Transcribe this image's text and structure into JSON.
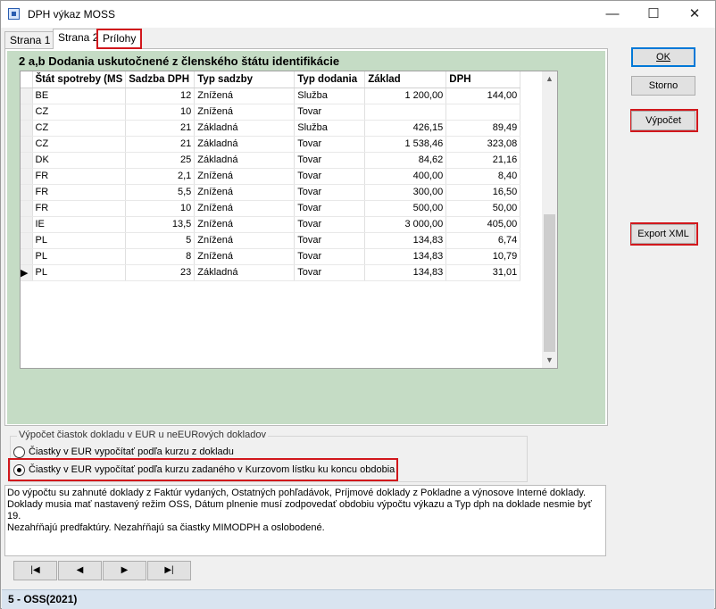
{
  "window": {
    "title": "DPH výkaz MOSS",
    "minimize": "—",
    "maximize": "☐",
    "close": "✕"
  },
  "tabs": [
    "Strana 1",
    "Strana 2",
    "Prílohy"
  ],
  "section_title": "2 a,b Dodania uskutočnené z členského štátu identifikácie",
  "table": {
    "columns": [
      "Štát spotreby (MS",
      "Sadzba DPH",
      "Typ sadzby",
      "Typ dodania",
      "Základ",
      "DPH"
    ],
    "rows": [
      [
        "BE",
        "12",
        "Znížená",
        "Služba",
        "1 200,00",
        "144,00"
      ],
      [
        "CZ",
        "10",
        "Znížená",
        "Tovar",
        "",
        ""
      ],
      [
        "CZ",
        "21",
        "Základná",
        "Služba",
        "426,15",
        "89,49"
      ],
      [
        "CZ",
        "21",
        "Základná",
        "Tovar",
        "1 538,46",
        "323,08"
      ],
      [
        "DK",
        "25",
        "Základná",
        "Tovar",
        "84,62",
        "21,16"
      ],
      [
        "FR",
        "2,1",
        "Znížená",
        "Tovar",
        "400,00",
        "8,40"
      ],
      [
        "FR",
        "5,5",
        "Znížená",
        "Tovar",
        "300,00",
        "16,50"
      ],
      [
        "FR",
        "10",
        "Znížená",
        "Tovar",
        "500,00",
        "50,00"
      ],
      [
        "IE",
        "13,5",
        "Znížená",
        "Tovar",
        "3 000,00",
        "405,00"
      ],
      [
        "PL",
        "5",
        "Znížená",
        "Tovar",
        "134,83",
        "6,74"
      ],
      [
        "PL",
        "8",
        "Znížená",
        "Tovar",
        "134,83",
        "10,79"
      ],
      [
        "PL",
        "23",
        "Základná",
        "Tovar",
        "134,83",
        "31,01"
      ]
    ],
    "current_row_marker": "▶"
  },
  "calc": {
    "legend": "Výpočet čiastok dokladu v EUR u neEURových dokladov",
    "option1": "Čiastky v EUR vypočítať podľa kurzu z dokladu",
    "option2": "Čiastky v EUR vypočítať podľa kurzu zadaného v Kurzovom lístku ku koncu obdobia"
  },
  "info_lines": [
    "Do výpočtu su zahnuté doklady z Faktúr vydaných, Ostatných pohľadávok, Príjmové doklady z Pokladne a výnosove Interné doklady.",
    "Doklady musia mať nastavený režim OSS, Dátum plnenie musí zodpovedať obdobiu výpočtu výkazu a Typ dph na doklade nesmie byť 19.",
    "Nezahŕňajú predfaktúry. Nezahŕňajú sa čiastky MIMODPH a oslobodené."
  ],
  "nav": {
    "first": "|◀",
    "prev": "◀",
    "next": "▶",
    "last": "▶|"
  },
  "buttons": {
    "ok": "OK",
    "storno": "Storno",
    "vypocet": "Výpočet",
    "export": "Export XML"
  },
  "status": "5 - OSS(2021)"
}
